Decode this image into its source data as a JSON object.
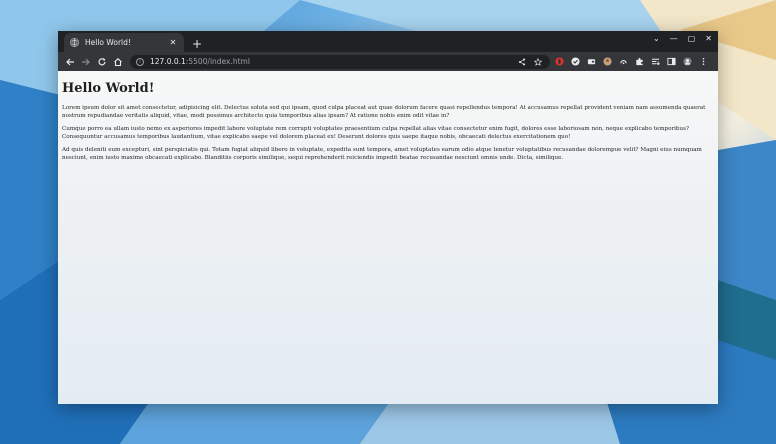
{
  "browser": {
    "tab": {
      "title": "Hello World!",
      "close": "✕"
    },
    "new_tab": "+",
    "window_controls": {
      "dropdown": "⌄",
      "minimize": "—",
      "maximize": "▢",
      "close": "✕"
    },
    "url": {
      "host": "127.0.0.1",
      "path": ":5500/index.html"
    }
  },
  "page": {
    "heading": "Hello World!",
    "paragraphs": [
      "Lorem ipsum dolor sit amet consectetur, adipisicing elit. Delectus soluta sed qui ipsam, quod culpa placeat aut quae dolorum facere quasi repellendus tempora! At accusamus repellat provident veniam nam assumenda quaerat nostrum repudiandae veritatis aliquid, vitae, modi possimus architecto quia temporibus alias ipsam? At ratione nobis enim odit vitae in?",
      "Cumque porro ea ullam iusto nemo ex asperiores impedit labore voluptate rem corrupti voluptates praesentium culpa repellat alias vitae consectetur enim fugit, dolores esse laboriosam non, neque explicabo temporibus? Consequuntur accusamus temporibus laudantium, vitae explicabo saepe vel dolorem placeat ex! Deserunt dolores quis saepe itaque nobis, obcaecati delectus exercitationem quo!",
      "Ad quis deleniti eum excepturi, sint perspiciatis qui. Totam fugiat aliquid libero in voluptate, expedita sunt tempora, amet voluptates earum odio atque tenetur voluptatibus recusandae dolorempue velit? Magni eius numquam nesciunt, enim iusto maxime obcaecati explicabo. Blanditiis corporis similique, sequi reprehenderit reiciendis impedit beatae recusandae nesciunt omnis unde. Dicta, similique."
    ]
  },
  "colors": {
    "titlebar": "#202124",
    "toolbar": "#35363a",
    "omnibox": "#202124"
  },
  "icons": [
    "globe-icon",
    "back-icon",
    "forward-icon",
    "reload-icon",
    "home-icon",
    "info-icon",
    "share-icon",
    "star-icon",
    "opera-extension-icon",
    "check-extension-icon",
    "wallet-extension-icon",
    "avatar-extension-icon",
    "cloud-extension-icon",
    "puzzle-icon",
    "reading-list-icon",
    "side-panel-icon",
    "profile-icon",
    "menu-icon"
  ]
}
